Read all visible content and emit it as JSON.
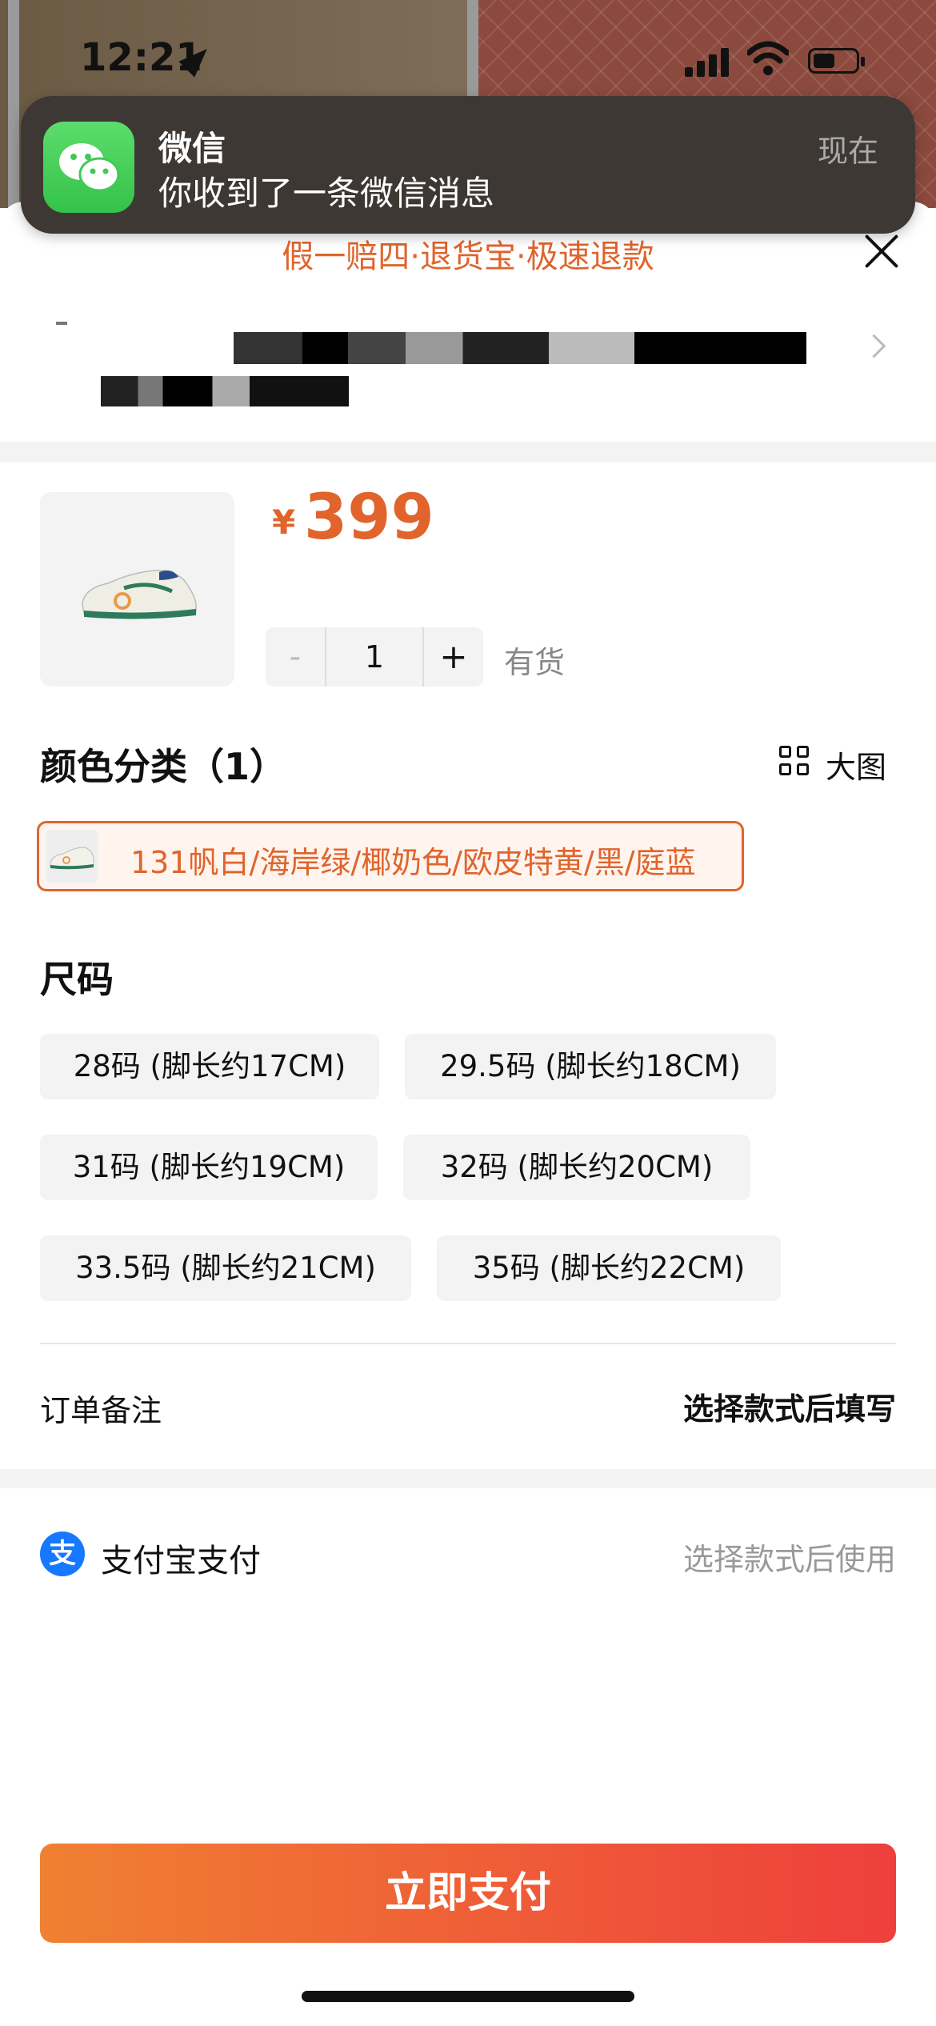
{
  "status_bar": {
    "time": "12:21"
  },
  "notification": {
    "app_name": "微信",
    "message": "你收到了一条微信消息",
    "time": "现在"
  },
  "guarantee_banner": "假一赔四·退货宝·极速退款",
  "product": {
    "currency": "¥",
    "price": "399",
    "quantity": "1",
    "decrement": "-",
    "increment": "+",
    "stock_status": "有货"
  },
  "color_section": {
    "title": "颜色分类（1）",
    "view_large_label": "大图",
    "options": [
      {
        "label": "131帆白/海岸绿/椰奶色/欧皮特黄/黑/庭蓝"
      }
    ]
  },
  "size_section": {
    "title": "尺码",
    "options": [
      {
        "label": "28码 (脚长约17CM)"
      },
      {
        "label": "29.5码 (脚长约18CM)"
      },
      {
        "label": "31码 (脚长约19CM)"
      },
      {
        "label": "32码 (脚长约20CM)"
      },
      {
        "label": "33.5码 (脚长约21CM)"
      },
      {
        "label": "35码 (脚长约22CM)"
      }
    ]
  },
  "order_note": {
    "label": "订单备注",
    "value": "选择款式后填写"
  },
  "payment": {
    "icon_glyph": "支",
    "method": "支付宝支付",
    "hint": "选择款式后使用"
  },
  "pay_button": "立即支付",
  "colors": {
    "accent": "#e0642c",
    "button_start": "#f08032",
    "button_end": "#ee3f3c",
    "alipay": "#1677ff",
    "wechat": "#34c24a"
  }
}
